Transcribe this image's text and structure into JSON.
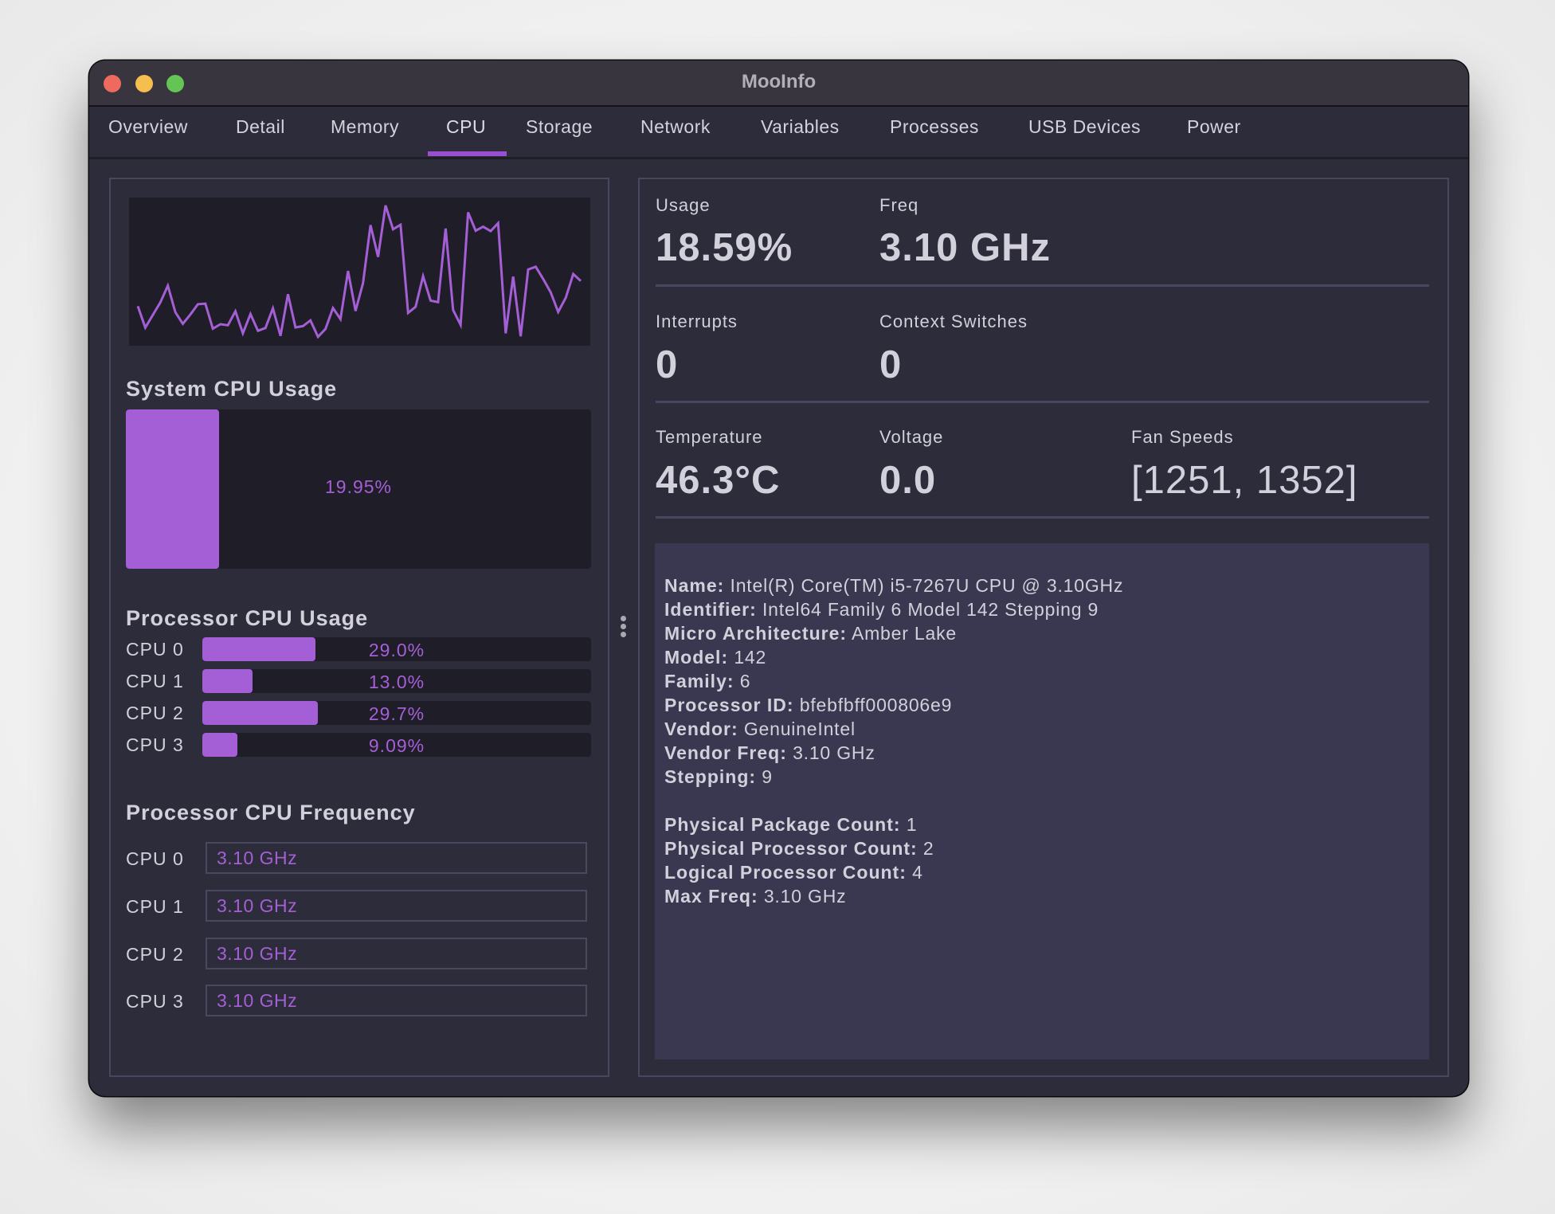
{
  "window": {
    "title": "MooInfo"
  },
  "traffic_lights": {
    "close": "#ee6a5f",
    "minimize": "#f5be4f",
    "zoom": "#62c554"
  },
  "tabs": [
    {
      "label": "Overview",
      "active": false
    },
    {
      "label": "Detail",
      "active": false
    },
    {
      "label": "Memory",
      "active": false
    },
    {
      "label": "CPU",
      "active": true
    },
    {
      "label": "Storage",
      "active": false
    },
    {
      "label": "Network",
      "active": false
    },
    {
      "label": "Variables",
      "active": false
    },
    {
      "label": "Processes",
      "active": false
    },
    {
      "label": "USB Devices",
      "active": false
    },
    {
      "label": "Power",
      "active": false
    }
  ],
  "colors": {
    "accent": "#a55fd6",
    "tab_underline": "#9a4fd2",
    "panel_bg": "#2d2c3a",
    "graph_bg": "#1f1e28",
    "info_bg": "#393850"
  },
  "chart_data": {
    "type": "line",
    "title": "",
    "series": [
      {
        "name": "CPU usage history",
        "values": [
          25.6,
          10.5,
          19.4,
          28.3,
          40.1,
          21.4,
          13.2,
          19.8,
          27.0,
          27.4,
          9.8,
          12.9,
          12.2,
          22.0,
          6.5,
          20.1,
          8.3,
          10.2,
          24.1,
          4.7,
          34.1,
          10.7,
          11.6,
          15.6,
          4.0,
          9.6,
          24.3,
          16.5,
          50.5,
          22.3,
          41.9,
          82.8,
          60.4,
          96.7,
          79.9,
          83.1,
          20.9,
          25.2,
          46.8,
          29.6,
          28.5,
          80.4,
          22.9,
          12.5,
          91.8,
          78.9,
          81.7,
          78.6,
          84.2,
          6.5,
          46.5,
          4.4,
          51.5,
          53.5,
          44.8,
          35.4,
          21.6,
          31.6,
          48.3,
          43.4
        ]
      }
    ],
    "ylim": [
      0,
      100
    ],
    "grid": false,
    "xlabel": "",
    "ylabel": ""
  },
  "system_cpu": {
    "heading": "System CPU Usage",
    "value_label": "19.95%",
    "fraction": 0.1995
  },
  "processor_usage": {
    "heading": "Processor CPU Usage",
    "cpus": [
      {
        "label": "CPU 0",
        "value_label": "29.0%",
        "fraction": 0.29
      },
      {
        "label": "CPU 1",
        "value_label": "13.0%",
        "fraction": 0.13
      },
      {
        "label": "CPU 2",
        "value_label": "29.7%",
        "fraction": 0.297
      },
      {
        "label": "CPU 3",
        "value_label": "9.09%",
        "fraction": 0.0909
      }
    ]
  },
  "processor_freq": {
    "heading": "Processor CPU Frequency",
    "cpus": [
      {
        "label": "CPU 0",
        "value": "3.10 GHz"
      },
      {
        "label": "CPU 1",
        "value": "3.10 GHz"
      },
      {
        "label": "CPU 2",
        "value": "3.10 GHz"
      },
      {
        "label": "CPU 3",
        "value": "3.10 GHz"
      }
    ]
  },
  "stats": {
    "usage": {
      "label": "Usage",
      "value": "18.59%"
    },
    "freq": {
      "label": "Freq",
      "value": "3.10 GHz"
    },
    "interrupts": {
      "label": "Interrupts",
      "value": "0"
    },
    "context_switches": {
      "label": "Context Switches",
      "value": "0"
    },
    "temperature": {
      "label": "Temperature",
      "value": "46.3°C"
    },
    "voltage": {
      "label": "Voltage",
      "value": "0.0"
    },
    "fan_speeds": {
      "label": "Fan Speeds",
      "value": "[1251, 1352]"
    }
  },
  "info": {
    "group1": [
      {
        "key": "Name:",
        "value": "Intel(R) Core(TM) i5-7267U CPU @ 3.10GHz"
      },
      {
        "key": "Identifier:",
        "value": "Intel64 Family 6 Model 142 Stepping 9"
      },
      {
        "key": "Micro Architecture:",
        "value": "Amber Lake"
      },
      {
        "key": "Model:",
        "value": "142"
      },
      {
        "key": "Family:",
        "value": "6"
      },
      {
        "key": "Processor ID:",
        "value": "bfebfbff000806e9"
      },
      {
        "key": "Vendor:",
        "value": "GenuineIntel"
      },
      {
        "key": "Vendor Freq:",
        "value": "3.10 GHz"
      },
      {
        "key": "Stepping:",
        "value": "9"
      }
    ],
    "group2": [
      {
        "key": "Physical Package Count:",
        "value": "1"
      },
      {
        "key": "Physical Processor Count:",
        "value": "2"
      },
      {
        "key": "Logical Processor Count:",
        "value": "4"
      },
      {
        "key": "Max Freq:",
        "value": "3.10 GHz"
      }
    ]
  }
}
